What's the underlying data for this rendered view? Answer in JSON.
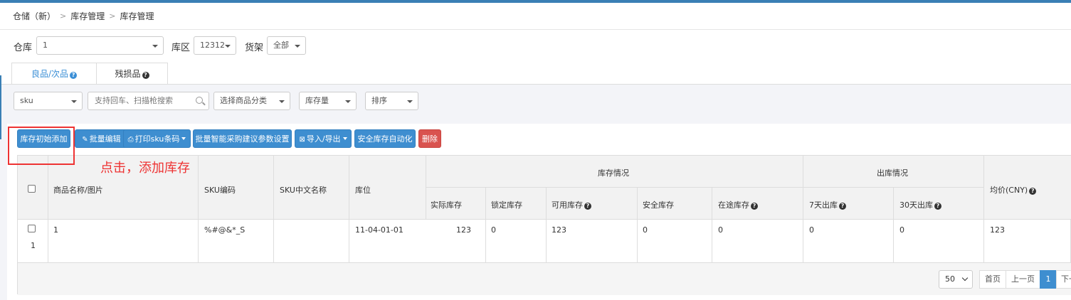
{
  "breadcrumb": {
    "root": "仓储（新）",
    "sep1": ">",
    "level1": "库存管理",
    "sep2": ">",
    "level2": "库存管理"
  },
  "filters": {
    "warehouse_label": "仓库",
    "warehouse_value": "1",
    "zone_label": "库区",
    "zone_value": "12312",
    "shelf_label": "货架",
    "shelf_value": "全部"
  },
  "tabs": [
    {
      "label": "良品/次品"
    },
    {
      "label": "残损品"
    }
  ],
  "search": {
    "field_select": "sku",
    "placeholder": "支持回车、扫描枪搜索",
    "category": "选择商品分类",
    "stock_qty": "库存量",
    "sort": "排序"
  },
  "toolbar": {
    "init_add": "库存初始添加",
    "batch_edit": "批量编辑",
    "print_sku": "打印sku条码",
    "smart_purchase": "批量智能采购建议参数设置",
    "import_export": "导入/导出",
    "safety_auto": "安全库存自动化",
    "delete": "删除"
  },
  "annotation": "点击，添加库存",
  "table": {
    "headers": {
      "name": "商品名称/图片",
      "sku": "SKU编码",
      "sku_cn": "SKU中文名称",
      "location": "库位",
      "stock_group": "库存情况",
      "out_group": "出库情况",
      "actual": "实际库存",
      "locked": "锁定库存",
      "available": "可用库存",
      "safety": "安全库存",
      "in_transit": "在途库存",
      "out7": "7天出库",
      "out30": "30天出库",
      "avg_price": "均价(CNY)"
    },
    "row": {
      "index": "1",
      "name": "1",
      "sku": "%#@&*_S",
      "sku_cn": "",
      "location": "11-04-01-01",
      "actual": "123",
      "locked": "0",
      "available": "123",
      "safety": "0",
      "in_transit": "0",
      "out7": "0",
      "out30": "0",
      "avg_price": "123"
    }
  },
  "pagination": {
    "page_size": "50",
    "first": "首页",
    "prev": "上一页",
    "current": "1",
    "next": "下一"
  },
  "colors": {
    "primary": "#3e8ed0",
    "danger": "#d9534f",
    "annotation": "#ee3333"
  }
}
